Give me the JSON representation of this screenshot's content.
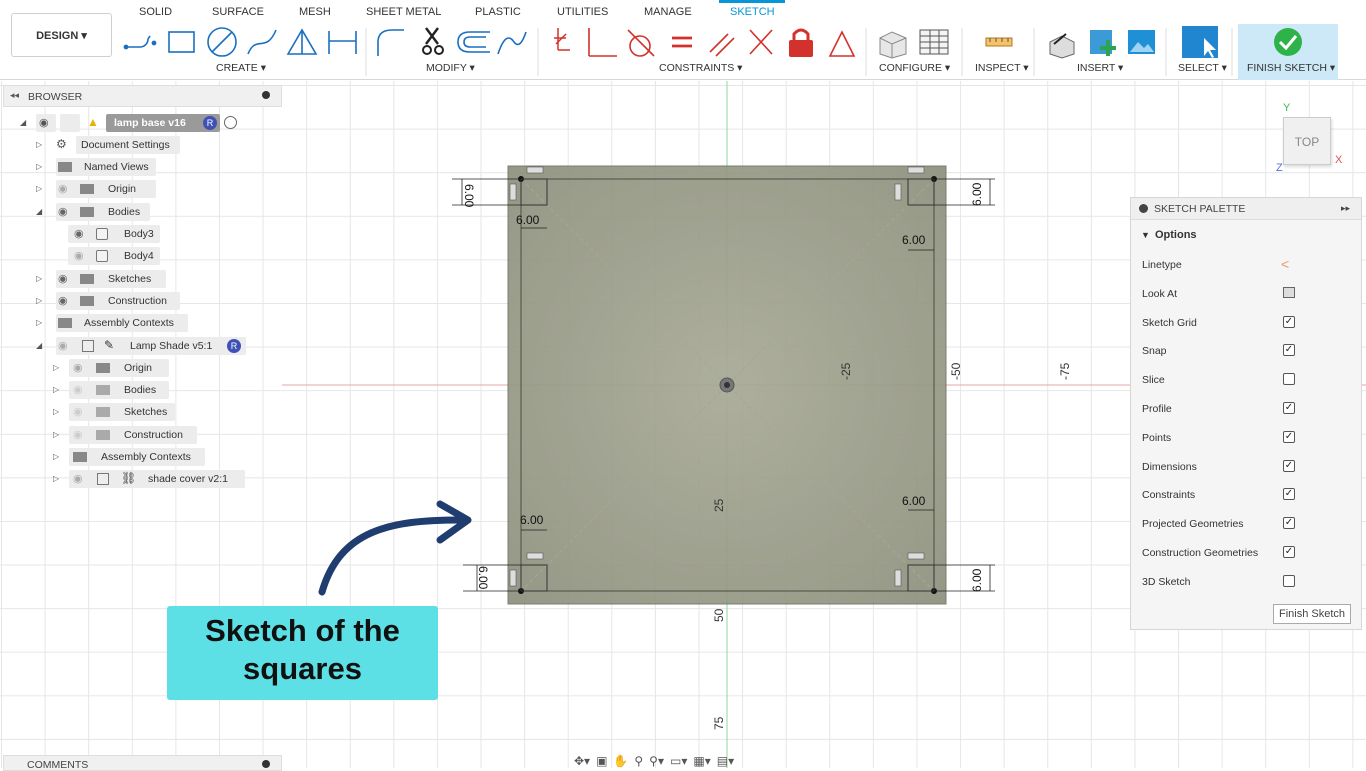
{
  "tabs": [
    "SOLID",
    "SURFACE",
    "MESH",
    "SHEET METAL",
    "PLASTIC",
    "UTILITIES",
    "MANAGE",
    "SKETCH"
  ],
  "workspace": "DESIGN ▾",
  "groups": {
    "create": "CREATE ▾",
    "modify": "MODIFY ▾",
    "constraints": "CONSTRAINTS ▾",
    "configure": "CONFIGURE ▾",
    "inspect": "INSPECT ▾",
    "insert": "INSERT ▾",
    "select": "SELECT ▾",
    "finish": "FINISH SKETCH ▾"
  },
  "browser": {
    "title": "BROWSER",
    "root": "lamp base v16",
    "items": [
      "Document Settings",
      "Named Views",
      "Origin",
      "Bodies",
      "Body3",
      "Body4",
      "Sketches",
      "Construction",
      "Assembly Contexts",
      "Lamp Shade v5:1",
      "Origin",
      "Bodies",
      "Sketches",
      "Construction",
      "Assembly Contexts",
      "shade cover v2:1"
    ]
  },
  "palette": {
    "title": "SKETCH PALETTE",
    "section": "Options",
    "options": [
      {
        "label": "Linetype",
        "kind": "linetype"
      },
      {
        "label": "Look At",
        "kind": "lookat"
      },
      {
        "label": "Sketch Grid",
        "checked": true
      },
      {
        "label": "Snap",
        "checked": true
      },
      {
        "label": "Slice",
        "checked": false
      },
      {
        "label": "Profile",
        "checked": true
      },
      {
        "label": "Points",
        "checked": true
      },
      {
        "label": "Dimensions",
        "checked": true
      },
      {
        "label": "Constraints",
        "checked": true
      },
      {
        "label": "Projected Geometries",
        "checked": true
      },
      {
        "label": "Construction Geometries",
        "checked": true
      },
      {
        "label": "3D Sketch",
        "checked": false
      }
    ],
    "finish_button": "Finish Sketch"
  },
  "viewcube": {
    "face": "TOP",
    "axis_x": "X",
    "axis_y": "Y",
    "axis_z": "Z"
  },
  "sketch": {
    "dims": [
      "6.00",
      "6.00",
      "6.00",
      "6.00",
      "6.00",
      "6.00",
      "6.00",
      "6.00"
    ],
    "axis_labels": [
      "-25",
      "-50",
      "-75",
      "25",
      "50",
      "75"
    ]
  },
  "comments": "COMMENTS",
  "callout": {
    "line1": "Sketch of the",
    "line2": "squares"
  },
  "colors": {
    "accent": "#0696d7",
    "callout": "#5ce0e6",
    "body": "#9a9c8c"
  }
}
